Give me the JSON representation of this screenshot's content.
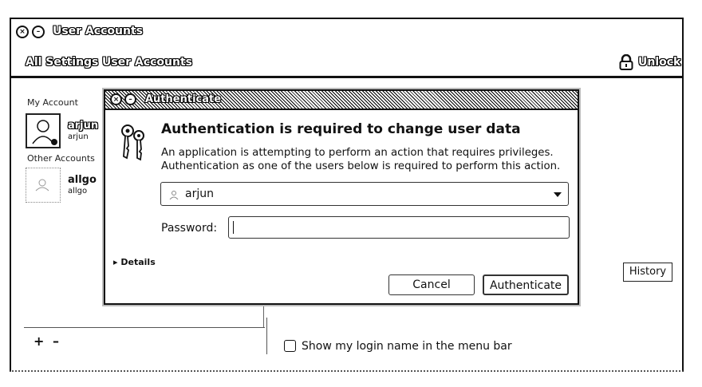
{
  "window": {
    "title": "User Accounts",
    "close_glyph": "×",
    "minimize_glyph": "–"
  },
  "toolbar": {
    "breadcrumbs": [
      "All Settings",
      "User Accounts"
    ],
    "unlock_label": "Unlock",
    "lock_icon": "lock-icon"
  },
  "sidebar": {
    "my_account_label": "My Account",
    "other_accounts_label": "Other Accounts",
    "accounts": [
      {
        "name": "arjun",
        "sub": "arjun"
      },
      {
        "name": "allgo",
        "sub": "allgo"
      }
    ],
    "add_label": "+",
    "remove_label": "–"
  },
  "details": {
    "history_label": "History",
    "show_login_label": "Show my login name in the menu bar",
    "show_login_checked": false
  },
  "dialog": {
    "title": "Authenticate",
    "heading": "Authentication is required to change user data",
    "message_line1": "An application is attempting to perform an action that requires privileges.",
    "message_line2": "Authentication as one of the users below is required to perform this action.",
    "selected_user": "arjun",
    "password_label": "Password:",
    "password_value": "",
    "details_label": "Details",
    "cancel_label": "Cancel",
    "authenticate_label": "Authenticate",
    "icon": "keys-icon"
  }
}
